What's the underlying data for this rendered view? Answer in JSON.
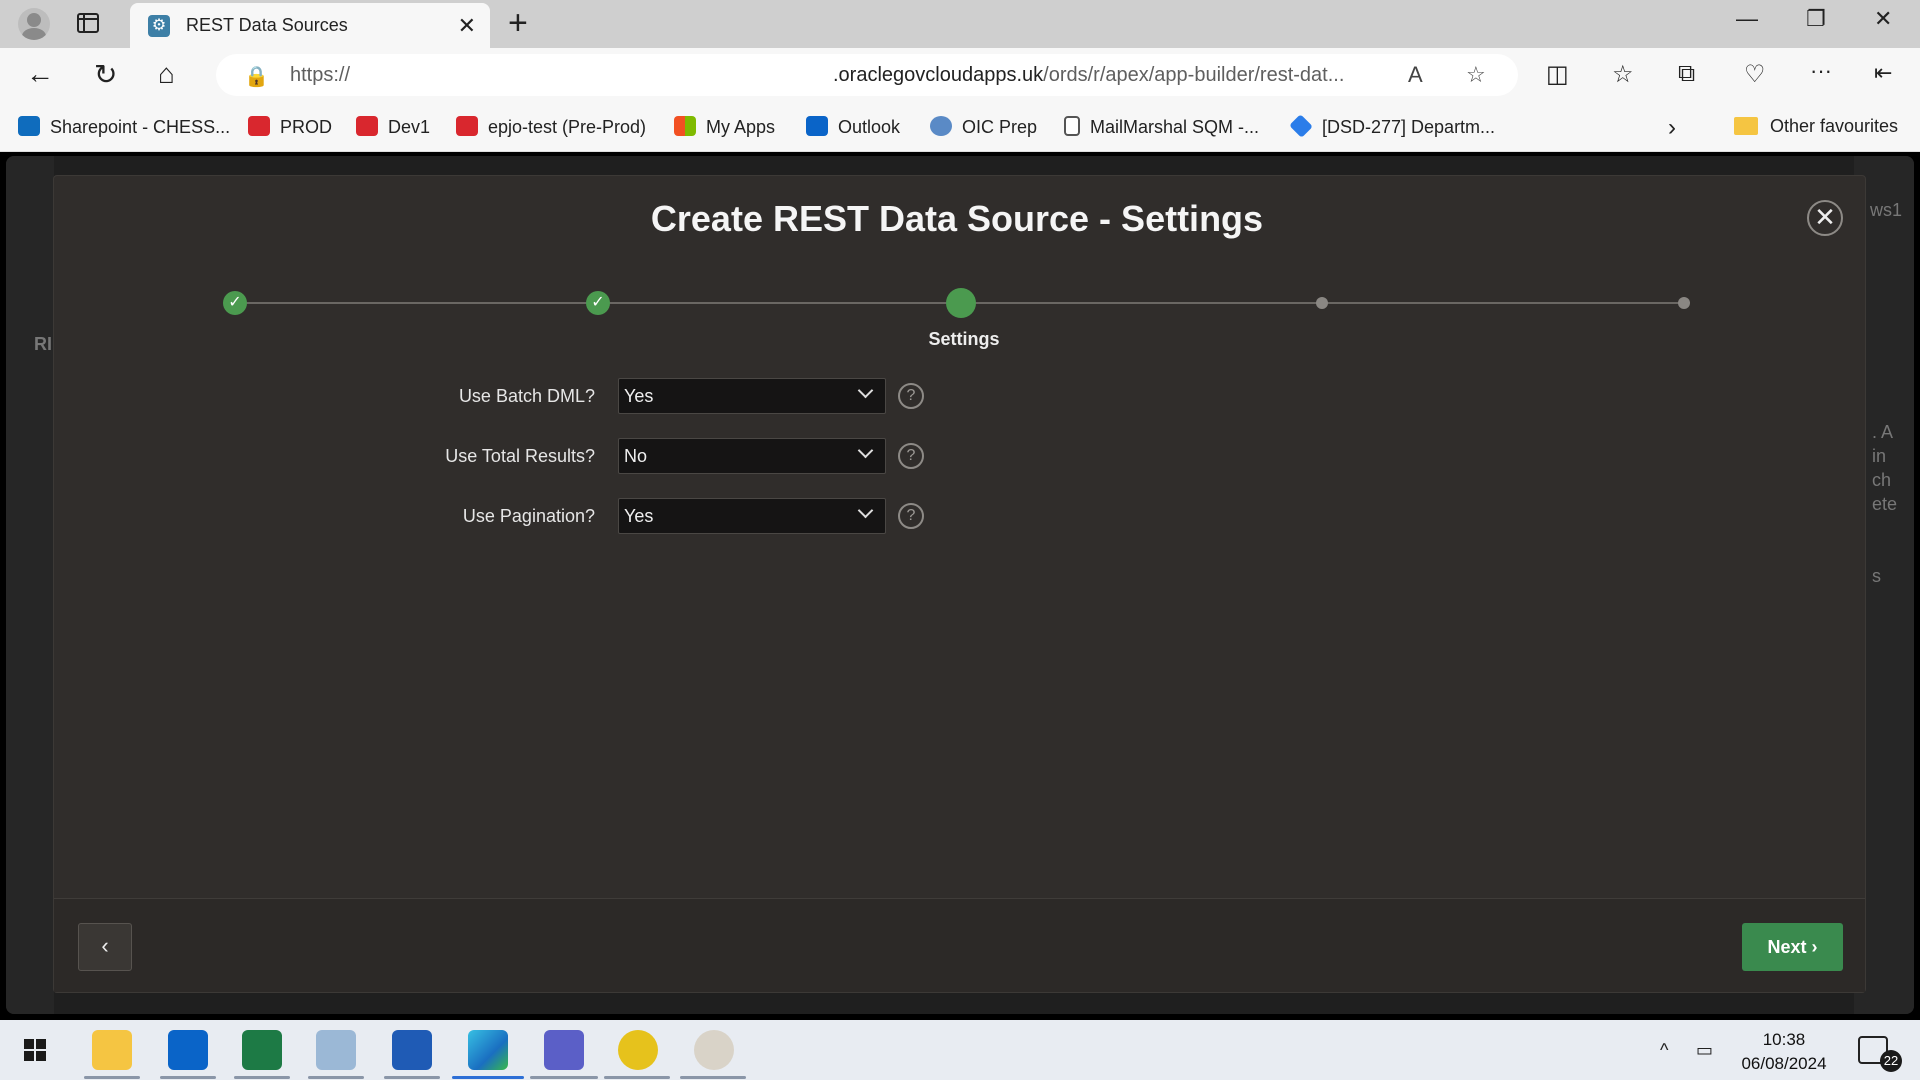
{
  "browser": {
    "tab_title": "REST Data Sources",
    "tab_close": "✕",
    "new_tab": "+",
    "window_controls": {
      "minimize": "—",
      "restore": "❐",
      "close": "✕"
    },
    "url_left": "https://",
    "url_domain": ".oraclegovcloudapps.uk",
    "url_path": "/ords/r/apex/app-builder/rest-dat...",
    "nav": {
      "back": "←",
      "refresh": "↻",
      "home": "⌂"
    },
    "url_icons": {
      "read_aloud": "A",
      "favorite": "☆"
    },
    "toolbar_icons": {
      "split": "◫",
      "favorites": "☆",
      "collections": "⧉",
      "health": "♡",
      "more": "···",
      "sidebar": "⇤"
    },
    "bookmarks": [
      {
        "label": "Sharepoint - CHESS...",
        "color": "#0f6cbd"
      },
      {
        "label": "PROD",
        "color": "#d9272e"
      },
      {
        "label": "Dev1",
        "color": "#d9272e"
      },
      {
        "label": "epjo-test (Pre-Prod)",
        "color": "#d9272e"
      },
      {
        "label": "My Apps",
        "color": "#f25022"
      },
      {
        "label": "Outlook",
        "color": "#0a64c8"
      },
      {
        "label": "OIC Prep",
        "color": "#5a8ac6"
      },
      {
        "label": "MailMarshal SQM -...",
        "color": "#555555"
      },
      {
        "label": "[DSD-277] Departm...",
        "color": "#2b7de9"
      }
    ],
    "bookmarks_more": "›",
    "other_favourites": "Other favourites"
  },
  "dialog": {
    "title": "Create REST Data Source - Settings",
    "close_glyph": "✕",
    "current_step_label": "Settings",
    "done_glyph": "✓",
    "fields": [
      {
        "label": "Use Batch DML?",
        "value": "Yes"
      },
      {
        "label": "Use Total Results?",
        "value": "No"
      },
      {
        "label": "Use Pagination?",
        "value": "Yes"
      }
    ],
    "help_glyph": "?",
    "prev_glyph": "‹",
    "next_label": "Next ›"
  },
  "background_page": {
    "user_fragment": "ws1",
    "side_fragment": "RI",
    "right_text": [
      ". A",
      "in",
      "ch",
      "ete",
      "s"
    ]
  },
  "taskbar": {
    "time": "10:38",
    "date": "06/08/2024",
    "notification_count": "22",
    "tray_chevron": "^"
  }
}
